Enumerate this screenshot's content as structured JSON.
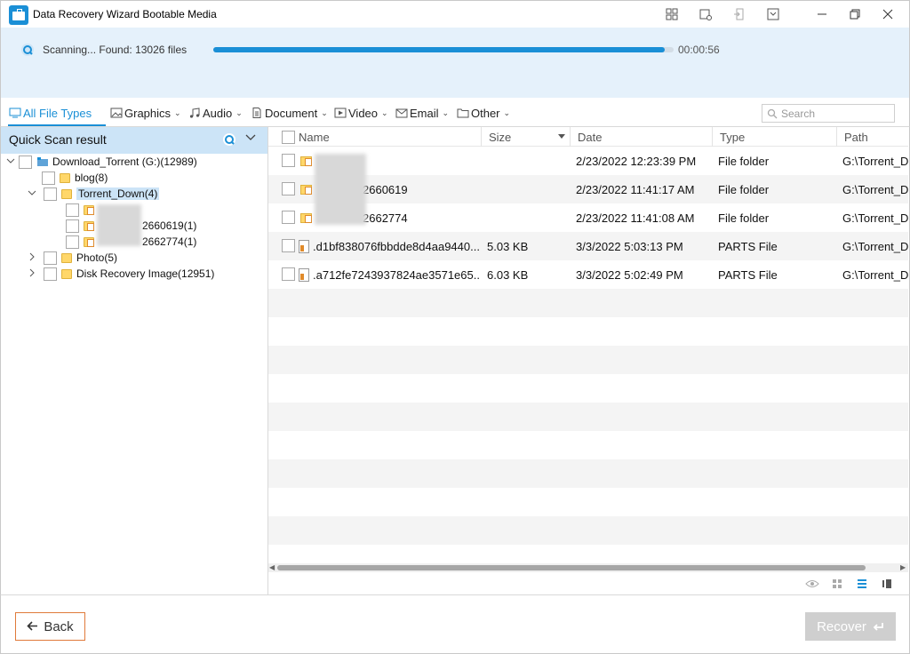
{
  "window": {
    "title": "Data Recovery Wizard Bootable Media"
  },
  "scan": {
    "status": "Scanning... Found: 13026 files",
    "progress_fraction": 0.98,
    "elapsed": "00:00:56"
  },
  "filters": [
    {
      "label": "All File Types",
      "icon": "monitor-icon",
      "active": true,
      "dropdown": false
    },
    {
      "label": "Graphics",
      "icon": "image-icon",
      "active": false,
      "dropdown": true
    },
    {
      "label": "Audio",
      "icon": "music-note-icon",
      "active": false,
      "dropdown": true
    },
    {
      "label": "Document",
      "icon": "document-icon",
      "active": false,
      "dropdown": true
    },
    {
      "label": "Video",
      "icon": "video-icon",
      "active": false,
      "dropdown": true
    },
    {
      "label": "Email",
      "icon": "envelope-icon",
      "active": false,
      "dropdown": true
    },
    {
      "label": "Other",
      "icon": "folder-icon",
      "active": false,
      "dropdown": true
    }
  ],
  "search": {
    "placeholder": "Search"
  },
  "tree": {
    "header": "Quick Scan result",
    "root": "Download_Torrent (G:)(12989)",
    "items": [
      {
        "label": "blog(8)"
      },
      {
        "label": "Torrent_Down(4)"
      },
      {
        "label": "2660619(1)"
      },
      {
        "label": "2662774(1)"
      },
      {
        "label": "Photo(5)"
      },
      {
        "label": "Disk Recovery Image(12951)"
      }
    ]
  },
  "table": {
    "columns": [
      "Name",
      "Size",
      "Date",
      "Type",
      "Path"
    ],
    "rows": [
      {
        "name": "",
        "size": "",
        "date": "2/23/2022 12:23:39 PM",
        "type": "File folder",
        "path": "G:\\Torrent_Do",
        "icon": "folder"
      },
      {
        "name": "2660619",
        "size": "",
        "date": "2/23/2022 11:41:17 AM",
        "type": "File folder",
        "path": "G:\\Torrent_Do",
        "icon": "folder"
      },
      {
        "name": "2662774",
        "size": "",
        "date": "2/23/2022 11:41:08 AM",
        "type": "File folder",
        "path": "G:\\Torrent_Do",
        "icon": "folder"
      },
      {
        "name": ".d1bf838076fbbdde8d4aa9440...",
        "size": "5.03 KB",
        "date": "3/3/2022 5:03:13 PM",
        "type": "PARTS File",
        "path": "G:\\Torrent_Do",
        "icon": "file"
      },
      {
        "name": ".a712fe7243937824ae3571e65...",
        "size": "6.03 KB",
        "date": "3/3/2022 5:02:49 PM",
        "type": "PARTS File",
        "path": "G:\\Torrent_Do",
        "icon": "file"
      }
    ]
  },
  "footer": {
    "back_label": "Back",
    "recover_label": "Recover"
  },
  "colors": {
    "accent": "#1a8fd6",
    "scan_bg": "#e5f1fb",
    "selected_bg": "#cce4f7",
    "back_border": "#e07a3a",
    "recover_disabled": "#cfcfcf"
  }
}
